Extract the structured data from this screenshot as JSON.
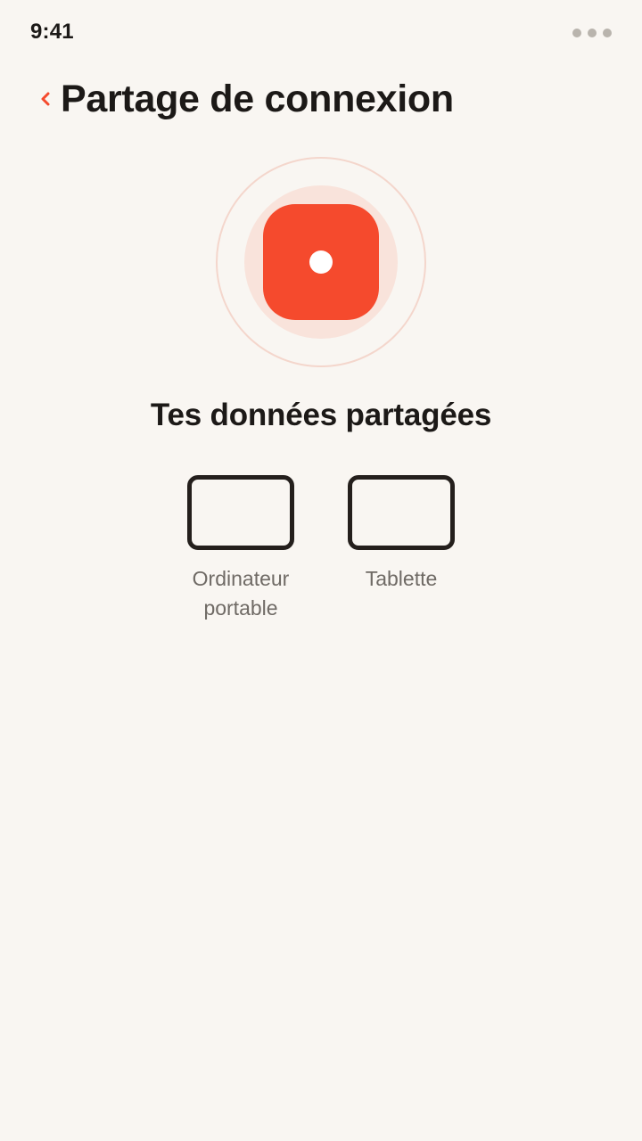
{
  "status_bar": {
    "time": "9:41"
  },
  "header": {
    "title": "Partage de connexion"
  },
  "hotspot": {
    "accent_color": "#f54a2d"
  },
  "section": {
    "title": "Tes données partagées"
  },
  "devices": [
    {
      "label": "Ordinateur\nportable",
      "icon": "laptop-icon"
    },
    {
      "label": "Tablette",
      "icon": "tablet-icon"
    }
  ]
}
